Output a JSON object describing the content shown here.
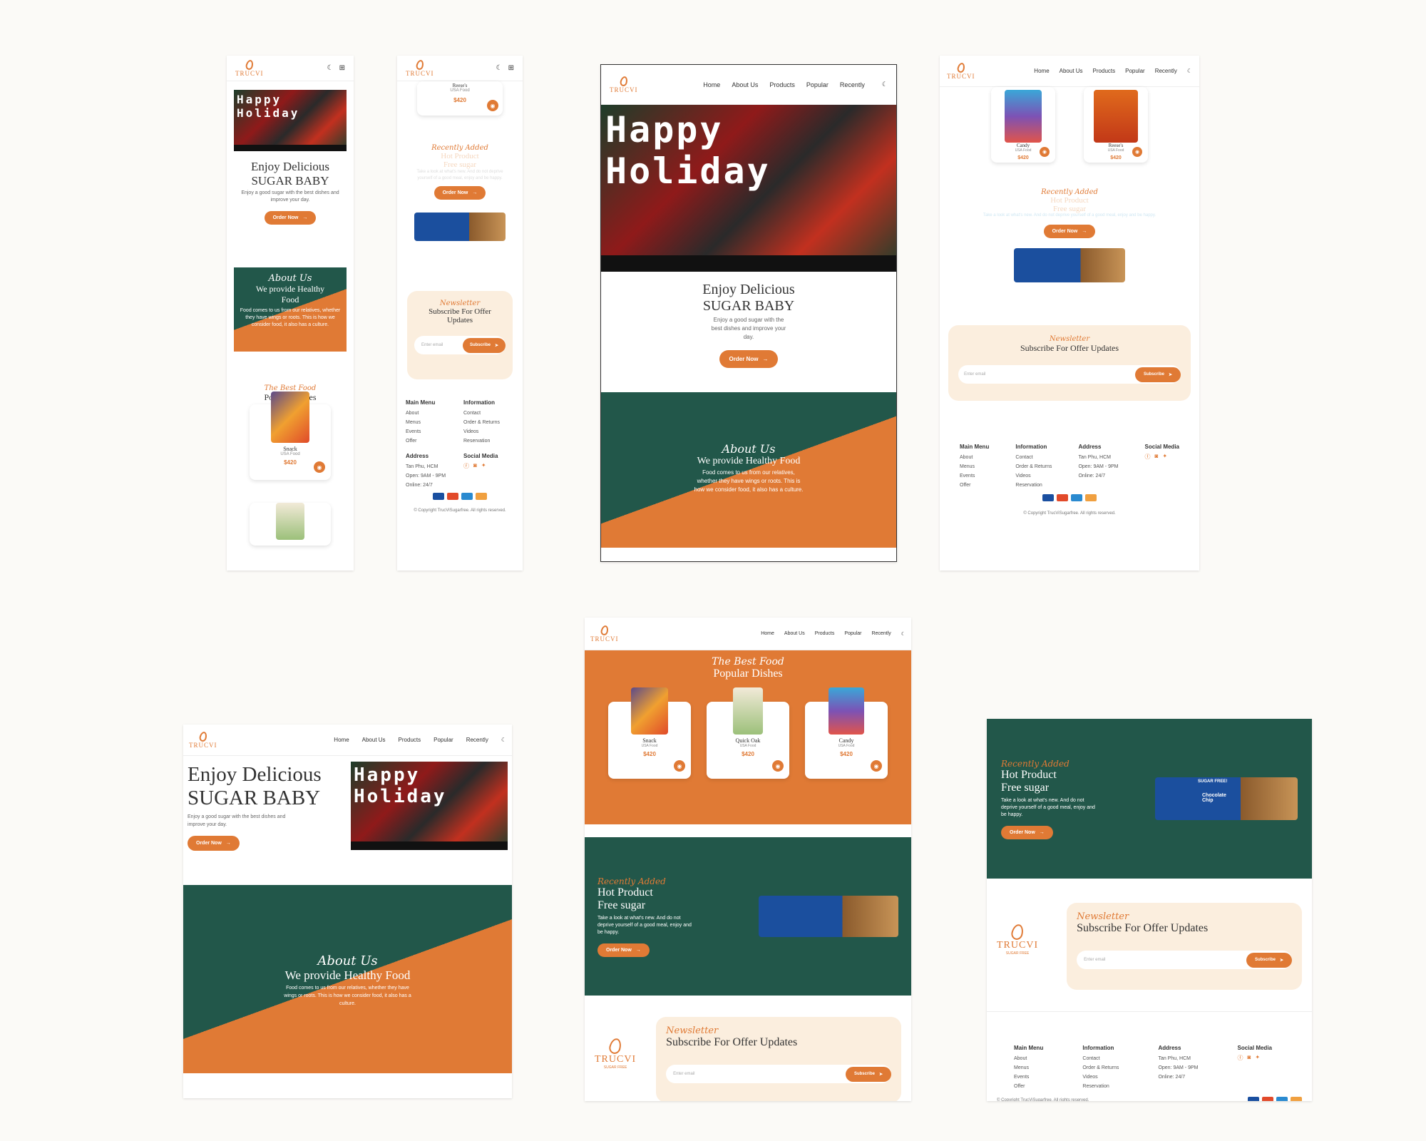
{
  "brand": {
    "name": "TRUCVI",
    "tagline": "SUGAR FREE"
  },
  "nav": {
    "items": [
      "Home",
      "About Us",
      "Products",
      "Popular",
      "Recently"
    ]
  },
  "hero": {
    "title1": "Enjoy Delicious",
    "title2": "SUGAR BABY",
    "text": "Enjoy a good sugar with the best dishes and improve your day.",
    "button": "Order Now",
    "banner": "Happy Holiday"
  },
  "about": {
    "subtitle": "About Us",
    "title": "We provide Healthy Food",
    "text": "Food comes to us from our relatives, whether they have wings or roots. This is how we consider food, it also has a culture."
  },
  "popular": {
    "subtitle": "The Best Food",
    "title": "Popular Dishes",
    "items": [
      {
        "name": "Snack",
        "origin": "USA Food",
        "price": "$420"
      },
      {
        "name": "Quick Oak",
        "origin": "USA Food",
        "price": "$420"
      },
      {
        "name": "Candy",
        "origin": "USA Food",
        "price": "$420"
      },
      {
        "name": "Reese's",
        "origin": "USA Food",
        "price": "$420"
      }
    ]
  },
  "recent": {
    "subtitle": "Recently Added",
    "title1": "Hot Product",
    "title2": "Free sugar",
    "text": "Take a look at what's new. And do not deprive yourself of a good meal, enjoy and be happy.",
    "button": "Order Now",
    "product": "Chocolate Chip",
    "badge": "SUGAR FREE!"
  },
  "newsletter": {
    "subtitle": "Newsletter",
    "title": "Subscribe For Offer Updates",
    "placeholder": "Enter email",
    "button": "Subscribe"
  },
  "footer": {
    "main_menu": {
      "title": "Main Menu",
      "items": [
        "About",
        "Menus",
        "Events",
        "Offer"
      ]
    },
    "information": {
      "title": "Information",
      "items": [
        "Contact",
        "Order & Returns",
        "Videos",
        "Reservation"
      ]
    },
    "address": {
      "title": "Address",
      "lines": [
        "Tan Phu, HCM",
        "Open: 9AM - 9PM",
        "Online: 24/7"
      ]
    },
    "social": {
      "title": "Social Media"
    },
    "copyright": "© Copyright TrucViSugarfree. All rights reserved."
  },
  "colors": {
    "accent": "#e07a35",
    "green": "#22574a",
    "cream": "#fbeede"
  }
}
